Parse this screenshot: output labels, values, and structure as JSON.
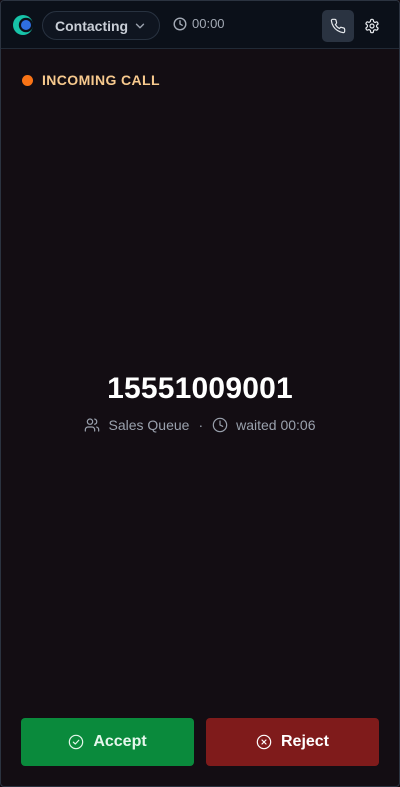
{
  "topbar": {
    "logo_icon": "app-logo-icon",
    "status": {
      "label": "Contacting",
      "icon": "chevron-down-icon"
    },
    "timer": {
      "icon": "clock-icon",
      "value": "00:00"
    },
    "phone_button": {
      "icon": "phone-icon"
    },
    "settings_button": {
      "icon": "gear-icon"
    }
  },
  "call": {
    "state_label": "INCOMING CALL",
    "state_color": "#f97316",
    "number": "15551009001",
    "queue": {
      "icon": "users-icon",
      "label": "Sales Queue"
    },
    "separator": "·",
    "waited": {
      "icon": "clock-icon",
      "label": "waited 00:06"
    }
  },
  "actions": {
    "accept": {
      "label": "Accept",
      "icon": "check-circle-icon",
      "color": "#0a8a3c"
    },
    "reject": {
      "label": "Reject",
      "icon": "x-circle-icon",
      "color": "#7f1b1b"
    }
  }
}
